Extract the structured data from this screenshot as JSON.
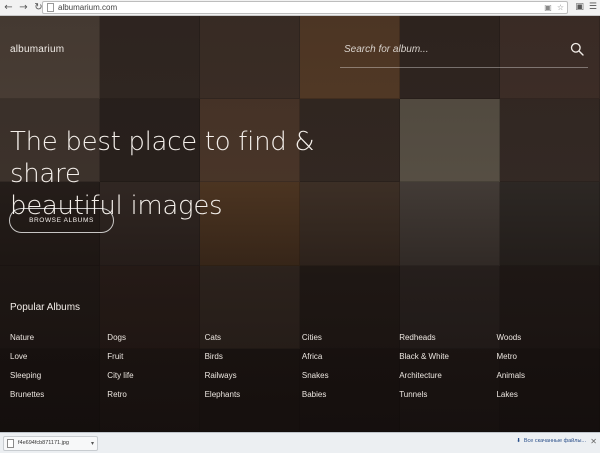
{
  "browser": {
    "url": "albumarium.com",
    "back_icon": "back-arrow-icon",
    "forward_icon": "forward-arrow-icon",
    "reload_icon": "reload-icon"
  },
  "header": {
    "logo": "albumarium",
    "search_placeholder": "Search for album..."
  },
  "hero": {
    "title_line1": "The best place to find & share",
    "title_line2": "beautiful images",
    "browse_label": "BROWSE ALBUMS"
  },
  "popular": {
    "title": "Popular Albums",
    "albums": [
      [
        "Nature",
        "Dogs",
        "Cats",
        "Cities",
        "Redheads",
        "Woods"
      ],
      [
        "Love",
        "Fruit",
        "Birds",
        "Africa",
        "Black & White",
        "Metro"
      ],
      [
        "Sleeping",
        "City life",
        "Railways",
        "Snakes",
        "Architecture",
        "Animals"
      ],
      [
        "Brunettes",
        "Retro",
        "Elephants",
        "Babies",
        "Tunnels",
        "Lakes"
      ]
    ]
  },
  "download_bar": {
    "file_name": "f4e694fcb871171.jpg",
    "show_all": "Все скачанные файлы..."
  },
  "colors": {
    "background": "#201915",
    "text": "#f4efea",
    "chrome": "#f2f2f2"
  }
}
